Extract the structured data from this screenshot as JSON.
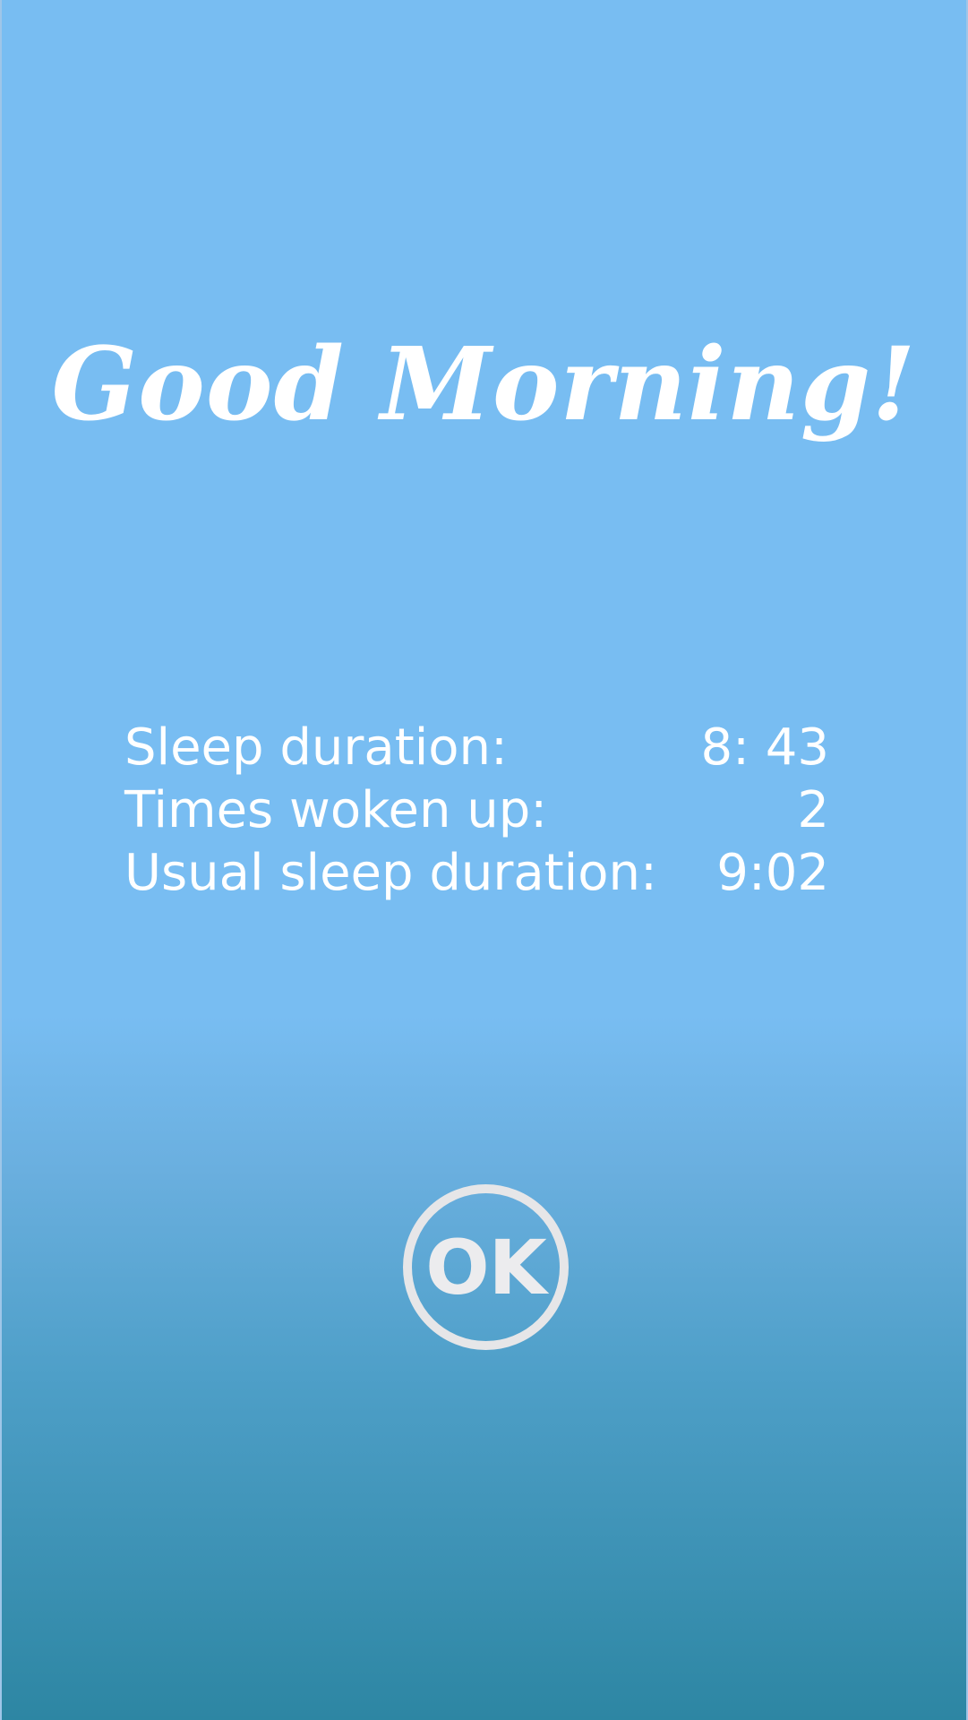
{
  "greeting": {
    "title": "Good Morning!"
  },
  "stats": [
    {
      "label": "Sleep duration:",
      "value": "8: 43"
    },
    {
      "label": "Times woken up:",
      "value": "2"
    },
    {
      "label": "Usual sleep duration:",
      "value": "9:02"
    }
  ],
  "actions": {
    "ok_label": "OK"
  },
  "colors": {
    "background_top": "#78bdf2",
    "background_bottom": "#2d86a3",
    "text": "#ffffff",
    "button_ring": "#e6e6e8"
  }
}
